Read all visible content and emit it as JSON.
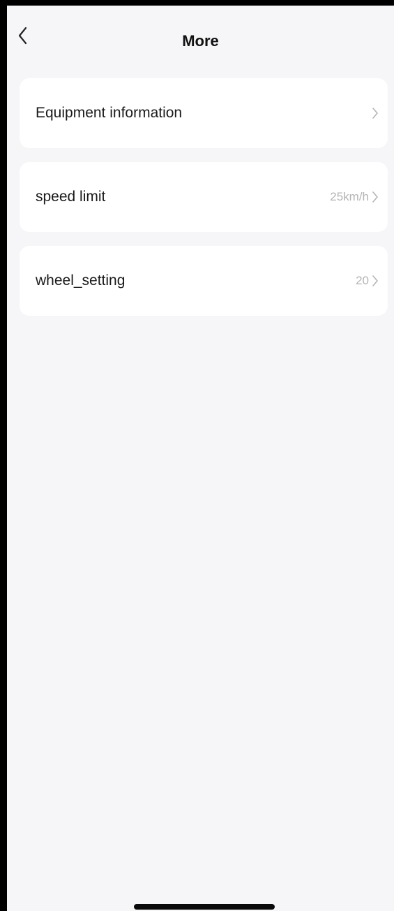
{
  "header": {
    "title": "More",
    "back_icon": "chevron-left-icon"
  },
  "items": [
    {
      "label": "Equipment information",
      "value": "",
      "icon": "chevron-right-icon"
    },
    {
      "label": "speed limit",
      "value": "25km/h",
      "icon": "chevron-right-icon"
    },
    {
      "label": "wheel_setting",
      "value": "20",
      "icon": "chevron-right-icon"
    }
  ],
  "colors": {
    "background": "#f6f5f7",
    "card": "#ffffff",
    "label": "#1a1a1a",
    "value": "#b4b4b4",
    "frame": "#000000"
  }
}
